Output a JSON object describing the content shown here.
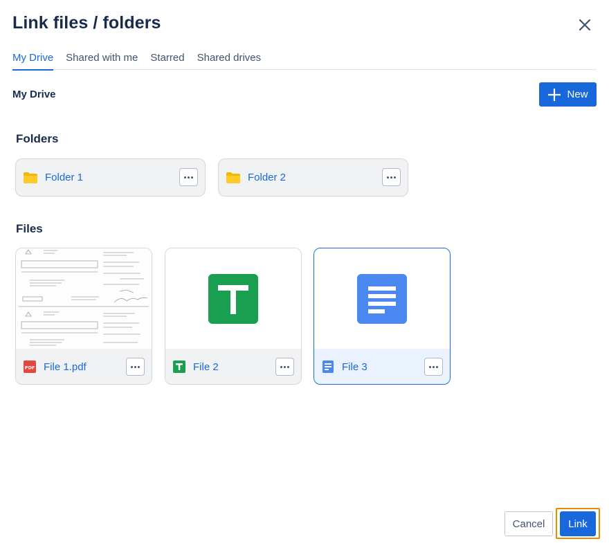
{
  "dialog": {
    "title": "Link files / folders"
  },
  "tabs": [
    {
      "label": "My Drive",
      "active": true
    },
    {
      "label": "Shared with me",
      "active": false
    },
    {
      "label": "Starred",
      "active": false
    },
    {
      "label": "Shared drives",
      "active": false
    }
  ],
  "location": {
    "title": "My Drive",
    "new_label": "New"
  },
  "folders": {
    "title": "Folders",
    "items": [
      {
        "name": "Folder 1",
        "icon": "folder-icon"
      },
      {
        "name": "Folder 2",
        "icon": "folder-icon"
      }
    ]
  },
  "files": {
    "title": "Files",
    "items": [
      {
        "name": "File 1.pdf",
        "icon": "pdf-icon",
        "selected": false
      },
      {
        "name": "File 2",
        "icon": "sheets-icon",
        "selected": false
      },
      {
        "name": "File 3",
        "icon": "docs-icon",
        "selected": true
      }
    ],
    "pdf_badge": "PDF"
  },
  "footer": {
    "cancel_label": "Cancel",
    "link_label": "Link"
  },
  "colors": {
    "accent": "#1868db",
    "folder": "#f5b800",
    "sheets": "#1a9e50",
    "docs": "#4a87f0",
    "pdf": "#e2483d",
    "focus": "#e68a00"
  }
}
